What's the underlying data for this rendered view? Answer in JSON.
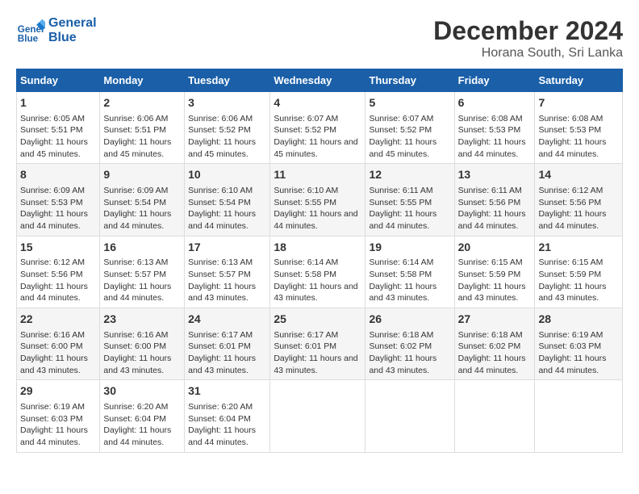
{
  "logo": {
    "line1": "General",
    "line2": "Blue"
  },
  "title": "December 2024",
  "subtitle": "Horana South, Sri Lanka",
  "days_of_week": [
    "Sunday",
    "Monday",
    "Tuesday",
    "Wednesday",
    "Thursday",
    "Friday",
    "Saturday"
  ],
  "weeks": [
    [
      {
        "day": "1",
        "sunrise": "6:05 AM",
        "sunset": "5:51 PM",
        "daylight": "11 hours and 45 minutes."
      },
      {
        "day": "2",
        "sunrise": "6:06 AM",
        "sunset": "5:51 PM",
        "daylight": "11 hours and 45 minutes."
      },
      {
        "day": "3",
        "sunrise": "6:06 AM",
        "sunset": "5:52 PM",
        "daylight": "11 hours and 45 minutes."
      },
      {
        "day": "4",
        "sunrise": "6:07 AM",
        "sunset": "5:52 PM",
        "daylight": "11 hours and 45 minutes."
      },
      {
        "day": "5",
        "sunrise": "6:07 AM",
        "sunset": "5:52 PM",
        "daylight": "11 hours and 45 minutes."
      },
      {
        "day": "6",
        "sunrise": "6:08 AM",
        "sunset": "5:53 PM",
        "daylight": "11 hours and 44 minutes."
      },
      {
        "day": "7",
        "sunrise": "6:08 AM",
        "sunset": "5:53 PM",
        "daylight": "11 hours and 44 minutes."
      }
    ],
    [
      {
        "day": "8",
        "sunrise": "6:09 AM",
        "sunset": "5:53 PM",
        "daylight": "11 hours and 44 minutes."
      },
      {
        "day": "9",
        "sunrise": "6:09 AM",
        "sunset": "5:54 PM",
        "daylight": "11 hours and 44 minutes."
      },
      {
        "day": "10",
        "sunrise": "6:10 AM",
        "sunset": "5:54 PM",
        "daylight": "11 hours and 44 minutes."
      },
      {
        "day": "11",
        "sunrise": "6:10 AM",
        "sunset": "5:55 PM",
        "daylight": "11 hours and 44 minutes."
      },
      {
        "day": "12",
        "sunrise": "6:11 AM",
        "sunset": "5:55 PM",
        "daylight": "11 hours and 44 minutes."
      },
      {
        "day": "13",
        "sunrise": "6:11 AM",
        "sunset": "5:56 PM",
        "daylight": "11 hours and 44 minutes."
      },
      {
        "day": "14",
        "sunrise": "6:12 AM",
        "sunset": "5:56 PM",
        "daylight": "11 hours and 44 minutes."
      }
    ],
    [
      {
        "day": "15",
        "sunrise": "6:12 AM",
        "sunset": "5:56 PM",
        "daylight": "11 hours and 44 minutes."
      },
      {
        "day": "16",
        "sunrise": "6:13 AM",
        "sunset": "5:57 PM",
        "daylight": "11 hours and 44 minutes."
      },
      {
        "day": "17",
        "sunrise": "6:13 AM",
        "sunset": "5:57 PM",
        "daylight": "11 hours and 43 minutes."
      },
      {
        "day": "18",
        "sunrise": "6:14 AM",
        "sunset": "5:58 PM",
        "daylight": "11 hours and 43 minutes."
      },
      {
        "day": "19",
        "sunrise": "6:14 AM",
        "sunset": "5:58 PM",
        "daylight": "11 hours and 43 minutes."
      },
      {
        "day": "20",
        "sunrise": "6:15 AM",
        "sunset": "5:59 PM",
        "daylight": "11 hours and 43 minutes."
      },
      {
        "day": "21",
        "sunrise": "6:15 AM",
        "sunset": "5:59 PM",
        "daylight": "11 hours and 43 minutes."
      }
    ],
    [
      {
        "day": "22",
        "sunrise": "6:16 AM",
        "sunset": "6:00 PM",
        "daylight": "11 hours and 43 minutes."
      },
      {
        "day": "23",
        "sunrise": "6:16 AM",
        "sunset": "6:00 PM",
        "daylight": "11 hours and 43 minutes."
      },
      {
        "day": "24",
        "sunrise": "6:17 AM",
        "sunset": "6:01 PM",
        "daylight": "11 hours and 43 minutes."
      },
      {
        "day": "25",
        "sunrise": "6:17 AM",
        "sunset": "6:01 PM",
        "daylight": "11 hours and 43 minutes."
      },
      {
        "day": "26",
        "sunrise": "6:18 AM",
        "sunset": "6:02 PM",
        "daylight": "11 hours and 43 minutes."
      },
      {
        "day": "27",
        "sunrise": "6:18 AM",
        "sunset": "6:02 PM",
        "daylight": "11 hours and 44 minutes."
      },
      {
        "day": "28",
        "sunrise": "6:19 AM",
        "sunset": "6:03 PM",
        "daylight": "11 hours and 44 minutes."
      }
    ],
    [
      {
        "day": "29",
        "sunrise": "6:19 AM",
        "sunset": "6:03 PM",
        "daylight": "11 hours and 44 minutes."
      },
      {
        "day": "30",
        "sunrise": "6:20 AM",
        "sunset": "6:04 PM",
        "daylight": "11 hours and 44 minutes."
      },
      {
        "day": "31",
        "sunrise": "6:20 AM",
        "sunset": "6:04 PM",
        "daylight": "11 hours and 44 minutes."
      },
      null,
      null,
      null,
      null
    ]
  ],
  "labels": {
    "sunrise": "Sunrise: ",
    "sunset": "Sunset: ",
    "daylight": "Daylight: "
  }
}
